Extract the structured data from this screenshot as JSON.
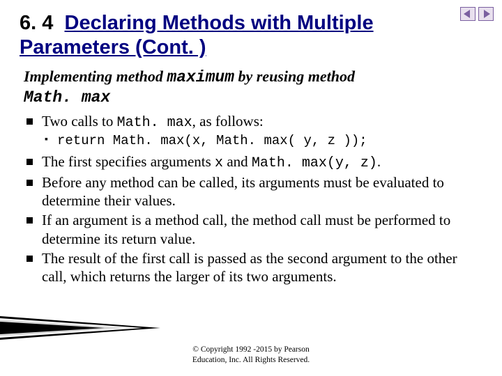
{
  "title": {
    "number": "6. 4",
    "text": "Declaring Methods with Multiple Parameters (Cont. )"
  },
  "subtitle": {
    "prefix": "Implementing method ",
    "code1": "maximum",
    "middle": " by reusing method ",
    "code2": "Math. max"
  },
  "bullets": [
    {
      "segments": [
        {
          "t": "Two calls to "
        },
        {
          "t": "Math. max",
          "mono": true
        },
        {
          "t": ", as follows:"
        }
      ],
      "sub": [
        {
          "t": "return Math. max(x, Math. max( y, z ));"
        }
      ]
    },
    {
      "segments": [
        {
          "t": "The first specifies arguments "
        },
        {
          "t": "x",
          "mono": true
        },
        {
          "t": " and "
        },
        {
          "t": "Math. max(y, z)",
          "mono": true
        },
        {
          "t": "."
        }
      ]
    },
    {
      "segments": [
        {
          "t": "Before any method can be called, its arguments must be evaluated to determine their values."
        }
      ]
    },
    {
      "segments": [
        {
          "t": "If an argument is a method call, the method call must be performed to determine its return value."
        }
      ]
    },
    {
      "segments": [
        {
          "t": "The result of the first call is passed as the second argument to the other call, which returns the larger of its two arguments."
        }
      ]
    }
  ],
  "footer": {
    "line1": "© Copyright 1992 -2015 by Pearson",
    "line2": "Education, Inc. All Rights Reserved."
  },
  "nav": {
    "prev_name": "prev-arrow-icon",
    "next_name": "next-arrow-icon"
  }
}
